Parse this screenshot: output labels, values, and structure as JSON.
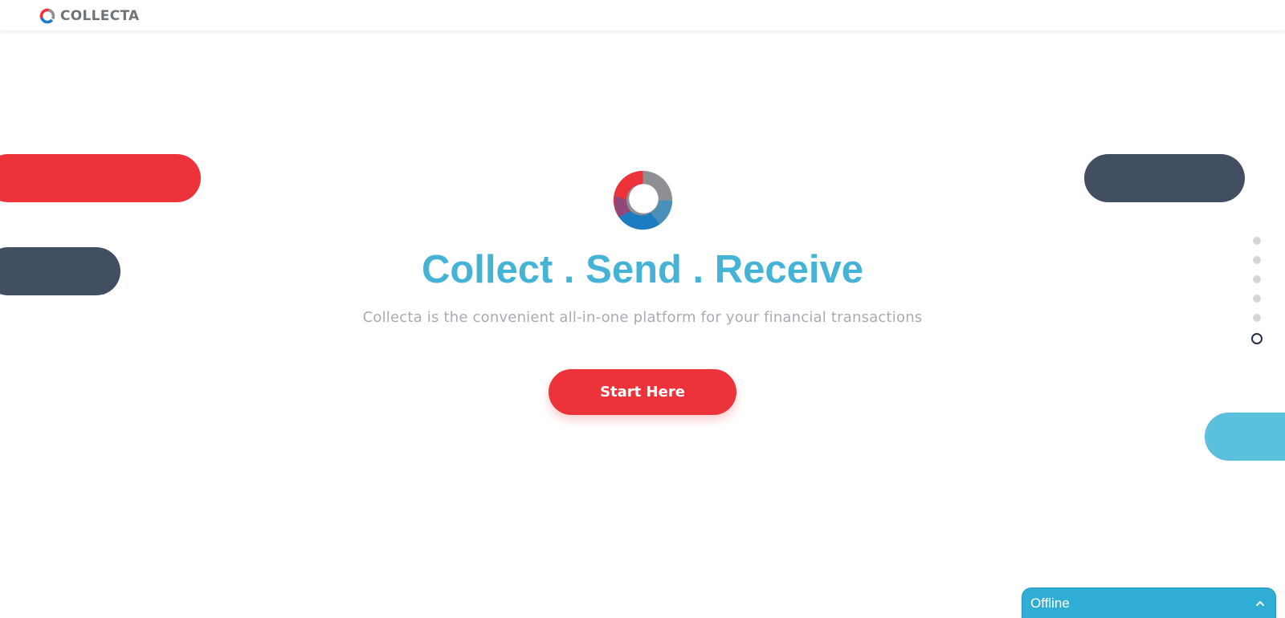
{
  "header": {
    "brand_name": "COLLECTA",
    "logo_icon": "collecta-ring-logo"
  },
  "hero": {
    "logo_icon": "collecta-ring-logo",
    "title": "Collect . Send . Receive",
    "subtitle": "Collecta is the convenient all-in-one platform for your financial transactions",
    "cta_label": "Start Here"
  },
  "section_nav": {
    "dot_count": 6,
    "active_index": 5
  },
  "chat": {
    "status_label": "Offline",
    "toggle_icon": "chevron-up-icon"
  },
  "colors": {
    "brand_red": "#ee3239",
    "brand_navy": "#424e62",
    "brand_blue": "#45b3d6",
    "light_blue": "#5bc0de",
    "chat_bg": "#2fadd4",
    "subtitle_gray": "#a7acb2"
  }
}
